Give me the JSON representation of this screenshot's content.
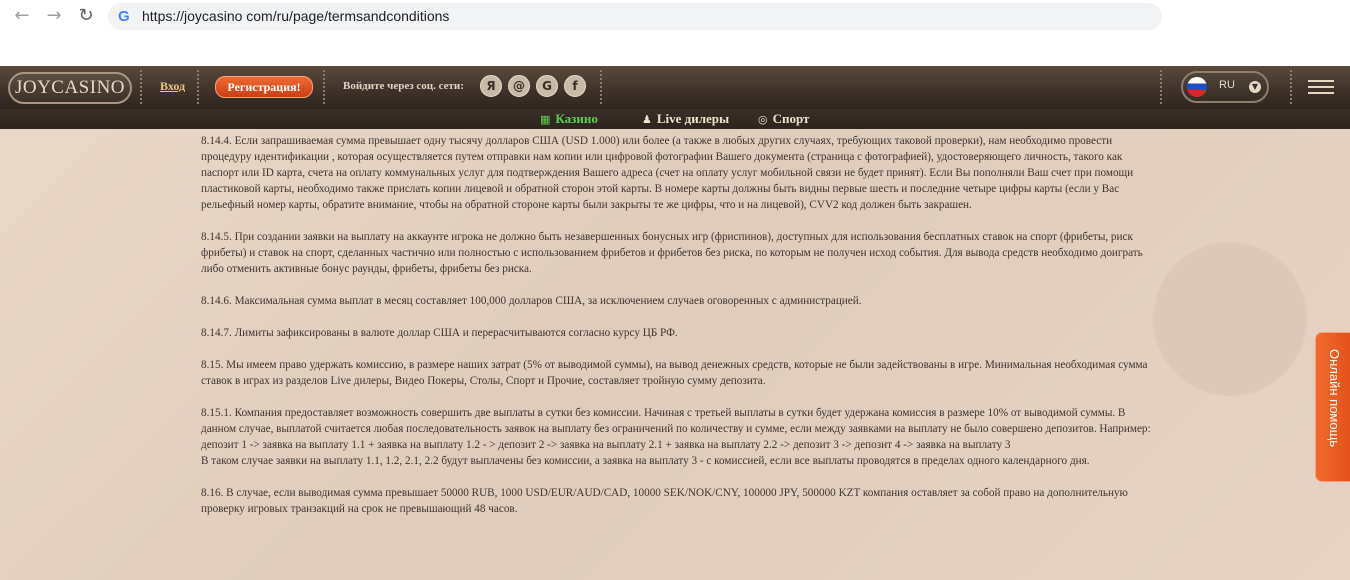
{
  "browser": {
    "back": "←",
    "forward": "→",
    "reload": "↻",
    "url": "https://joycasino com/ru/page/termsandconditions"
  },
  "header": {
    "logo": "JOYCASINO",
    "login": "Вход",
    "register": "Регистрация!",
    "social_label": "Войдите через соц. сети:",
    "social": [
      "Я",
      "@",
      "G",
      "f"
    ],
    "language": "RU"
  },
  "subnav": [
    {
      "label": "Казино",
      "icon": "slot-icon",
      "glyph": "▦",
      "color": "#5fcf4b"
    },
    {
      "label": "Live дилеры",
      "icon": "dealer-icon",
      "glyph": "♟",
      "color": "#efe2cd"
    },
    {
      "label": "Спорт",
      "icon": "ball-icon",
      "glyph": "◎",
      "color": "#efe2cd"
    }
  ],
  "content": {
    "paragraphs": [
      "8.14.4. Если запрашиваемая сумма превышает одну тысячу долларов США (USD 1.000) или более (а также в любых других случаях, требующих таковой проверки), нам необходимо провести процедуру идентификации , которая осуществляется путем отправки нам копии или цифровой фотографии Вашего документа (страница с фотографией), удостоверяющего личность, такого как паспорт или ID карта, счета на оплату коммунальных услуг для подтверждения Вашего адреса (счет на оплату услуг мобильной связи не будет принят). Если Вы пополняли Ваш счет при помощи пластиковой карты, необходимо также прислать копии лицевой и обратной сторон этой карты. В номере карты должны быть видны первые шесть и последние четыре цифры карты (если у Вас рельефный номер карты, обратите внимание, чтобы на обратной стороне карты были закрыты те же цифры, что и на лицевой), CVV2 код должен быть закрашен.",
      "8.14.5. При создании заявки на выплату на аккаунте игрока не должно быть незавершенных бонусных игр (фриспинов), доступных для использования бесплатных ставок на спорт (фрибеты, риск фрибеты) и ставок на спорт, сделанных частично или полностью с использованием фрибетов и фрибетов без риска, по которым не получен исход события. Для вывода средств необходимо доиграть либо отменить активные бонус раунды, фрибеты, фрибеты без риска.",
      "8.14.6. Максимальная сумма выплат в месяц составляет 100,000 долларов США, за исключением случаев оговоренных с администрацией.",
      "8.14.7. Лимиты зафиксированы в валюте доллар США и перерасчитываются согласно курсу ЦБ РФ.",
      "8.15. Мы имеем право удержать комиссию, в размере наших затрат (5% от выводимой суммы), на вывод денежных средств, которые не были задействованы в игре. Минимальная необходимая сумма ставок в играх из разделов Live дилеры, Видео Покеры, Столы, Спорт и Прочие, составляет тройную сумму депозита.",
      "8.15.1. Компания предоставляет возможность совершить две выплаты в сутки без комиссии. Начиная с третьей выплаты в сутки будет удержана комиссия в размере 10% от выводимой суммы. В данном случае, выплатой считается любая последовательность заявок на выплату без ограничений по количеству и сумме, если между заявками на выплату не было совершено депозитов. Например:\nдепозит 1 -> заявка на выплату 1.1 + заявка на выплату 1.2 - > депозит 2 -> заявка на выплату 2.1 + заявка на выплату 2.2 -> депозит 3 -> депозит 4 -> заявка на выплату 3\nВ таком случае заявки на выплату 1.1, 1.2, 2.1, 2.2 будут выплачены без комиссии, а заявка на выплату 3 - с комиссией, если все выплаты проводятся в пределах одного календарного дня.",
      "8.16. В случае, если выводимая сумма превышает 50000 RUB, 1000 USD/EUR/AUD/CAD, 10000 SEK/NOK/CNY, 100000 JPY, 500000 KZT компания оставляет за собой право на дополнительную проверку игровых транзакций на срок не превышающий 48 часов."
    ]
  },
  "help_tab": "Онлайн помощь"
}
